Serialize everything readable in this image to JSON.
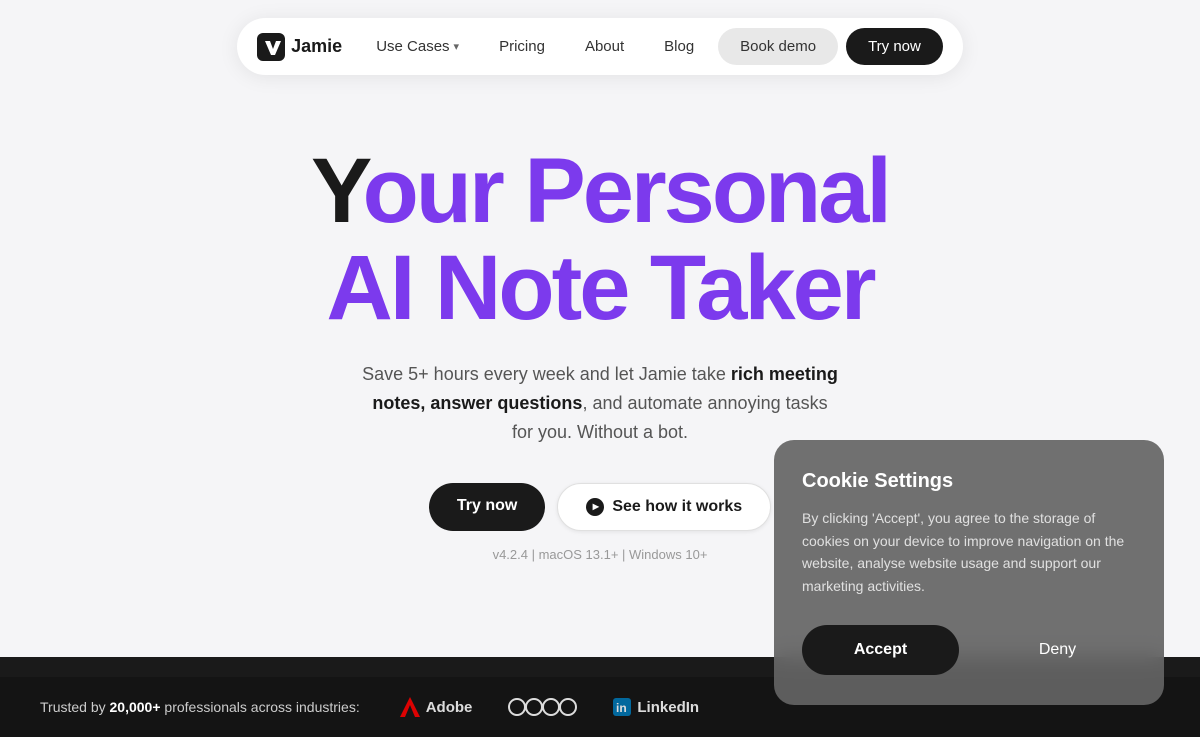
{
  "nav": {
    "logo_text": "Jamie",
    "links": [
      {
        "id": "use-cases",
        "label": "Use Cases",
        "has_arrow": true
      },
      {
        "id": "pricing",
        "label": "Pricing",
        "has_arrow": false
      },
      {
        "id": "about",
        "label": "About",
        "has_arrow": false
      },
      {
        "id": "blog",
        "label": "Blog",
        "has_arrow": false
      }
    ],
    "book_demo_label": "Book demo",
    "try_now_label": "Try now"
  },
  "hero": {
    "title_line1_a": "Your Personal",
    "title_line2": "AI Note Taker",
    "subtitle": "Save 5+ hours every week and let Jamie take rich meeting notes, answer questions, and automate annoying tasks for you. Without a bot.",
    "subtitle_bold1": "rich meeting notes, answer questions",
    "btn_try_label": "Try now",
    "btn_see_how_label": "See how it works",
    "version_text": "v4.2.4 | macOS 13.1+ | Windows 10+"
  },
  "trusted": {
    "label": "Trusted by 20,000+ professionals across industries:",
    "logos": [
      {
        "name": "Adobe",
        "type": "text-with-icon"
      },
      {
        "name": "Audi",
        "type": "rings"
      },
      {
        "name": "LinkedIn",
        "type": "text"
      }
    ]
  },
  "cookie": {
    "title": "Cookie Settings",
    "body": "By clicking 'Accept', you agree to the storage of cookies on your device to improve navigation on the website, analyse website usage and support our marketing activities.",
    "accept_label": "Accept",
    "deny_label": "Deny"
  }
}
